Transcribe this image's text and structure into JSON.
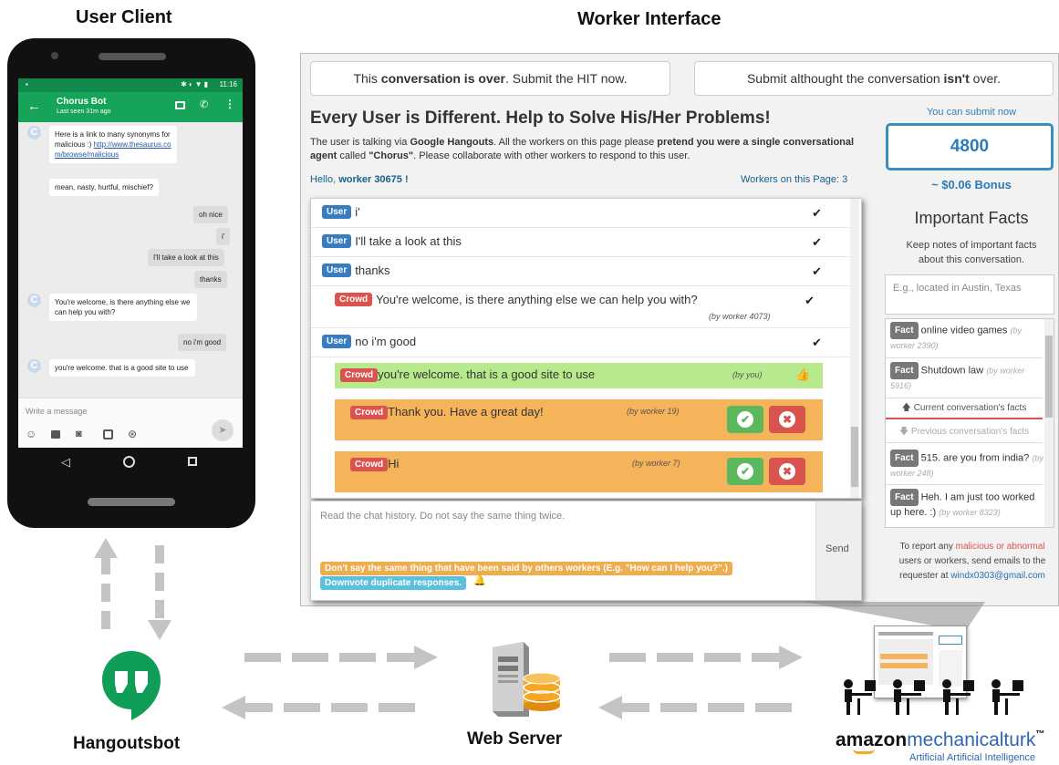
{
  "titles": {
    "user_client": "User Client",
    "worker_interface": "Worker Interface",
    "hangouts": "Hangoutsbot",
    "web_server": "Web Server",
    "mturk_brand": "amazon",
    "mturk_name": "mechanicalturk",
    "mturk_tm": "™",
    "mturk_tagline": "Artificial Artificial Intelligence"
  },
  "phone": {
    "time": "11:16",
    "contact": "Chorus Bot",
    "last_seen": "Last seen 31m ago",
    "messages": [
      {
        "from": "bot",
        "text": "Here is a link to many synonyms for malicious :)",
        "link": "http://www.thesaurus.com/browse/malicious"
      },
      {
        "from": "bot",
        "text": "mean, nasty, hurtful, mischief?"
      },
      {
        "from": "me",
        "text": "oh nice"
      },
      {
        "from": "me",
        "text": "i'"
      },
      {
        "from": "me",
        "text": "I'll take a look at this"
      },
      {
        "from": "me",
        "text": "thanks"
      },
      {
        "from": "bot",
        "text": "You're welcome, is there anything else we can help you with?"
      },
      {
        "from": "me",
        "text": "no i'm good"
      },
      {
        "from": "bot",
        "text": "you're welcome. that is a good site to use"
      }
    ],
    "composer_placeholder": "Write a message"
  },
  "worker": {
    "btn_over_pre": "This ",
    "btn_over_bold": "conversation is over",
    "btn_over_post": ". Submit the HIT now.",
    "btn_notover_pre": "Submit althought the conversation ",
    "btn_notover_bold": "isn't",
    "btn_notover_post": " over.",
    "heading": "Every User is Different. Help to Solve His/Her Problems!",
    "desc_1": "The user is talking via ",
    "desc_b1": "Google Hangouts",
    "desc_2": ". All the workers on this page please ",
    "desc_b2": "pretend you were a single conversational agent",
    "desc_3": " called ",
    "desc_b3": "\"Chorus\"",
    "desc_4": ". Please collaborate with other workers to respond to this user.",
    "hello": "Hello, ",
    "worker_name": "worker 30675",
    "hello_end": " !",
    "workers_on_page": "Workers on this Page: 3",
    "history": [
      {
        "role": "User",
        "text": "i'"
      },
      {
        "role": "User",
        "text": "I'll take a look at this"
      },
      {
        "role": "User",
        "text": "thanks"
      },
      {
        "role": "Crowd",
        "text": "You're welcome, is there anything else we can help you with?",
        "by": "(by worker 4073)"
      },
      {
        "role": "User",
        "text": "no i'm good"
      }
    ],
    "candidates": [
      {
        "role": "Crowd",
        "text": "you're welcome. that is a good site to use",
        "by": "(by you)"
      },
      {
        "role": "Crowd",
        "text": "Thank you. Have a great day!",
        "by": "(by worker 19)"
      },
      {
        "role": "Crowd",
        "text": "Hi",
        "by": "(by worker 7)"
      }
    ],
    "input_placeholder": "Read the chat history. Do not say the same thing twice.",
    "send": "Send",
    "tip_1": "Don't say the same thing that have been said by others workers (E.g. \"How can I help you?\".)",
    "tip_2": "Downvote duplicate responses.",
    "submit_now": "You can submit now",
    "score": "4800",
    "bonus": "~ $0.06 Bonus",
    "facts_title": "Important Facts",
    "facts_desc": "Keep notes of important facts about this conversation.",
    "facts_placeholder": "E.g., located in Austin, Texas",
    "current_facts": [
      {
        "label": "Fact",
        "text": "online video games",
        "by": "(by worker 2390)"
      },
      {
        "label": "Fact",
        "text": "Shutdown law",
        "by": "(by worker 5916)"
      }
    ],
    "current_label": "Current conversation's facts",
    "previous_label": "Previous conversation's facts",
    "previous_facts": [
      {
        "label": "Fact",
        "text": "515. are you from india?",
        "by": "(by worker 248)"
      },
      {
        "label": "Fact",
        "text": "Heh. I am just too worked up here. :)",
        "by": "(by worker 8323)"
      }
    ],
    "report_1": "To report any ",
    "report_colored": "malicious or abnormal",
    "report_2": " users or workers, send emails to the requester at ",
    "email": "windx0303@gmail.com"
  },
  "colors": {
    "user_badge": "#3a7cc1",
    "crowd_badge": "#d9534f",
    "own_candidate": "#b7ea8c",
    "other_candidate": "#f5b35a",
    "upvote": "#5cb85c",
    "downvote": "#d9534f",
    "hangouts_green": "#0f9d58",
    "server_orange": "#f5a623"
  }
}
